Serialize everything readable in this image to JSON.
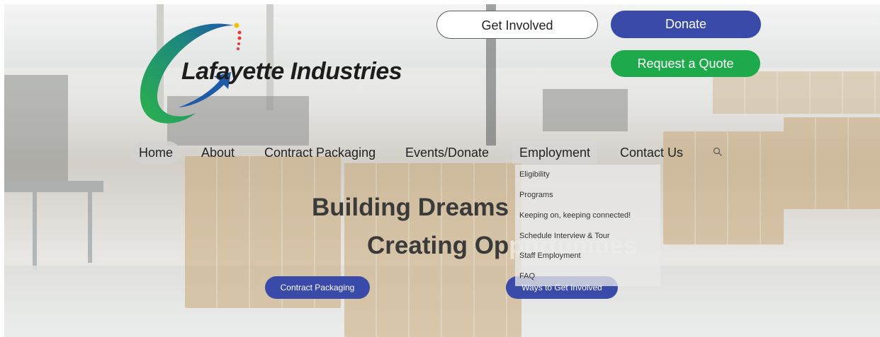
{
  "header": {
    "logo_text": "Lafayette Industries",
    "get_involved": "Get Involved",
    "donate": "Donate",
    "request_quote": "Request a Quote"
  },
  "nav": {
    "items": [
      {
        "label": "Home"
      },
      {
        "label": "About"
      },
      {
        "label": "Contract Packaging"
      },
      {
        "label": "Events/Donate"
      },
      {
        "label": "Employment"
      },
      {
        "label": "Contact Us"
      }
    ]
  },
  "employment_menu": {
    "items": [
      {
        "label": "Eligibility"
      },
      {
        "label": "Programs"
      },
      {
        "label": "Keeping on, keeping connected!"
      },
      {
        "label": "Schedule Interview & Tour"
      },
      {
        "label": "Staff Employment"
      },
      {
        "label": "FAQ"
      }
    ]
  },
  "hero": {
    "line1": "Building Dreams",
    "line2_main": "Creating Op",
    "line2_faded": "portunities",
    "cta_left": "Contract Packaging",
    "cta_right": "Ways to Get Involved"
  },
  "colors": {
    "accent_blue": "#3a4aa8",
    "accent_green": "#1eaa4b"
  },
  "icons": {
    "search": "magnifier"
  }
}
